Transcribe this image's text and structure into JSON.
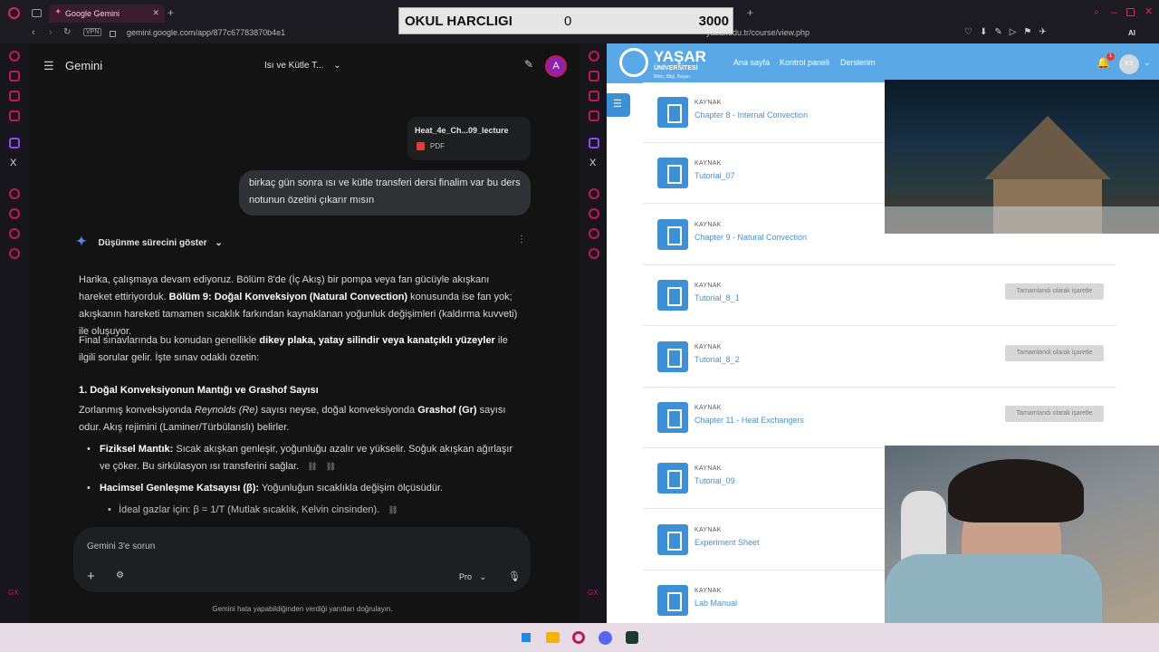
{
  "overlay": {
    "label": "OKUL HARCLIGI",
    "value": "0",
    "target": "3000"
  },
  "left_browser": {
    "tab_title": "Google Gemini",
    "vpn": "VPN",
    "url": "gemini.google.com/app/877c67783870b4e1"
  },
  "gemini": {
    "title": "Gemini",
    "chat_title": "Isı ve Kütle T...",
    "avatar": "A",
    "file_name": "Heat_4e_Ch...09_lecture",
    "file_type": "PDF",
    "user_message": "birkaç gün sonra ısı ve kütle transferi dersi finalim var bu ders notunun özetini çıkarır mısın",
    "thinking_label": "Düşünme sürecini göster",
    "p1_a": "Harika, çalışmaya devam ediyoruz. Bölüm 8'de (İç Akış) bir pompa veya fan gücüyle akışkanı hareket ettiriyorduk. ",
    "p1_b": "Bölüm 9: Doğal Konveksiyon (Natural Convection)",
    "p1_c": " konusunda ise fan yok; akışkanın hareketi tamamen sıcaklık farkından kaynaklanan yoğunluk değişimleri (kaldırma kuvveti) ile oluşuyor.",
    "p2_a": "Final sınavlarında bu konudan genellikle ",
    "p2_b": "dikey plaka, yatay silindir veya kanatçıklı yüzeyler",
    "p2_c": " ile ilgili sorular gelir. İşte sınav odaklı özetin:",
    "h1": "1. Doğal Konveksiyonun Mantığı ve Grashof Sayısı",
    "p3_a": "Zorlanmış konveksiyonda ",
    "p3_i": "Reynolds (Re)",
    "p3_b": " sayısı neyse, doğal konveksiyonda ",
    "p3_c": "Grashof (Gr)",
    "p3_d": " sayısı odur. Akış rejimini (Laminer/Türbülanslı) belirler.",
    "b1_t": "Fiziksel Mantık:",
    "b1": " Sıcak akışkan genleşir, yoğunluğu azalır ve yükselir. Soğuk akışkan ağırlaşır ve çöker. Bu sirkülasyon ısı transferini sağlar.",
    "b2_t": "Hacimsel Genleşme Katsayısı (β):",
    "b2": " Yoğunluğun sıcaklıkla değişim ölçüsüdür.",
    "sub1": "İdeal gazlar için: β = 1/T (Mutlak sıcaklık, Kelvin cinsinden).",
    "input_placeholder": "Gemini 3'e sorun",
    "mode": "Pro",
    "footer": "Gemini hata yapabildiğinden verdiği yanıtları doğrulayın."
  },
  "right_browser": {
    "url": "yasar.edu.tr/course/view.php",
    "ai": "AI"
  },
  "moodle": {
    "logo_main": "YAŞAR",
    "logo_sub": "ÜNİVERSİTESİ",
    "logo_tag": "Bilim, Bilgi, Başarı",
    "nav": [
      "Ana sayfa",
      "Kontrol paneli",
      "Derslerim"
    ],
    "notif_badge": "1",
    "user_initials": "KS",
    "resource_label": "KAYNAK",
    "done_label": "Tamamlandı olarak işaretle",
    "items": [
      {
        "title": "Chapter 8 - Internal Convection",
        "done": false
      },
      {
        "title": "Tutorial_07",
        "done": false
      },
      {
        "title": "Chapter 9 - Natural Convection",
        "done": false
      },
      {
        "title": "Tutorial_8_1",
        "done": true
      },
      {
        "title": "Tutorial_8_2",
        "done": true
      },
      {
        "title": "Chapter 11 - Heat Exchangers",
        "done": true
      },
      {
        "title": "Tutorial_09",
        "done": false
      },
      {
        "title": "Experiment Sheet",
        "done": false
      },
      {
        "title": "Lab Manual",
        "done": false
      }
    ]
  },
  "colors": {
    "accent_pink": "#c2185b",
    "gemini_bg": "#131314",
    "moodle_blue": "#5aa8e6",
    "link": "#4a90c8"
  }
}
